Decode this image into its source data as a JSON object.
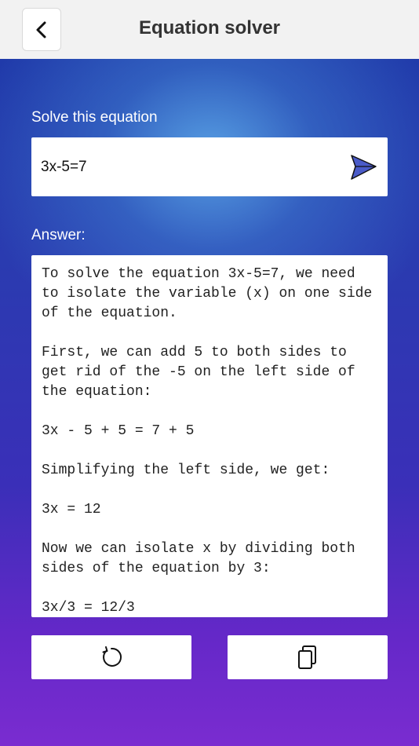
{
  "header": {
    "title": "Equation solver",
    "back_icon": "chevron-left-icon"
  },
  "form": {
    "prompt_label": "Solve this equation",
    "equation_value": "3x-5=7",
    "send_icon": "paper-plane-icon",
    "send_icon_color": "#4a5bc8"
  },
  "answer": {
    "label": "Answer:",
    "text": "To solve the equation 3x-5=7, we need to isolate the variable (x) on one side of the equation.\n\nFirst, we can add 5 to both sides to get rid of the -5 on the left side of the equation:\n\n3x - 5 + 5 = 7 + 5\n\nSimplifying the left side, we get:\n\n3x = 12\n\nNow we can isolate x by dividing both sides of the equation by 3:\n\n3x/3 = 12/3"
  },
  "actions": {
    "reset_icon": "refresh-icon",
    "copy_icon": "copy-icon"
  },
  "colors": {
    "header_bg": "#f2f2f2",
    "gradient_top": "#1d3aa8",
    "gradient_center_glow": "#5aa5e6",
    "gradient_bottom": "#7a2cd0"
  }
}
